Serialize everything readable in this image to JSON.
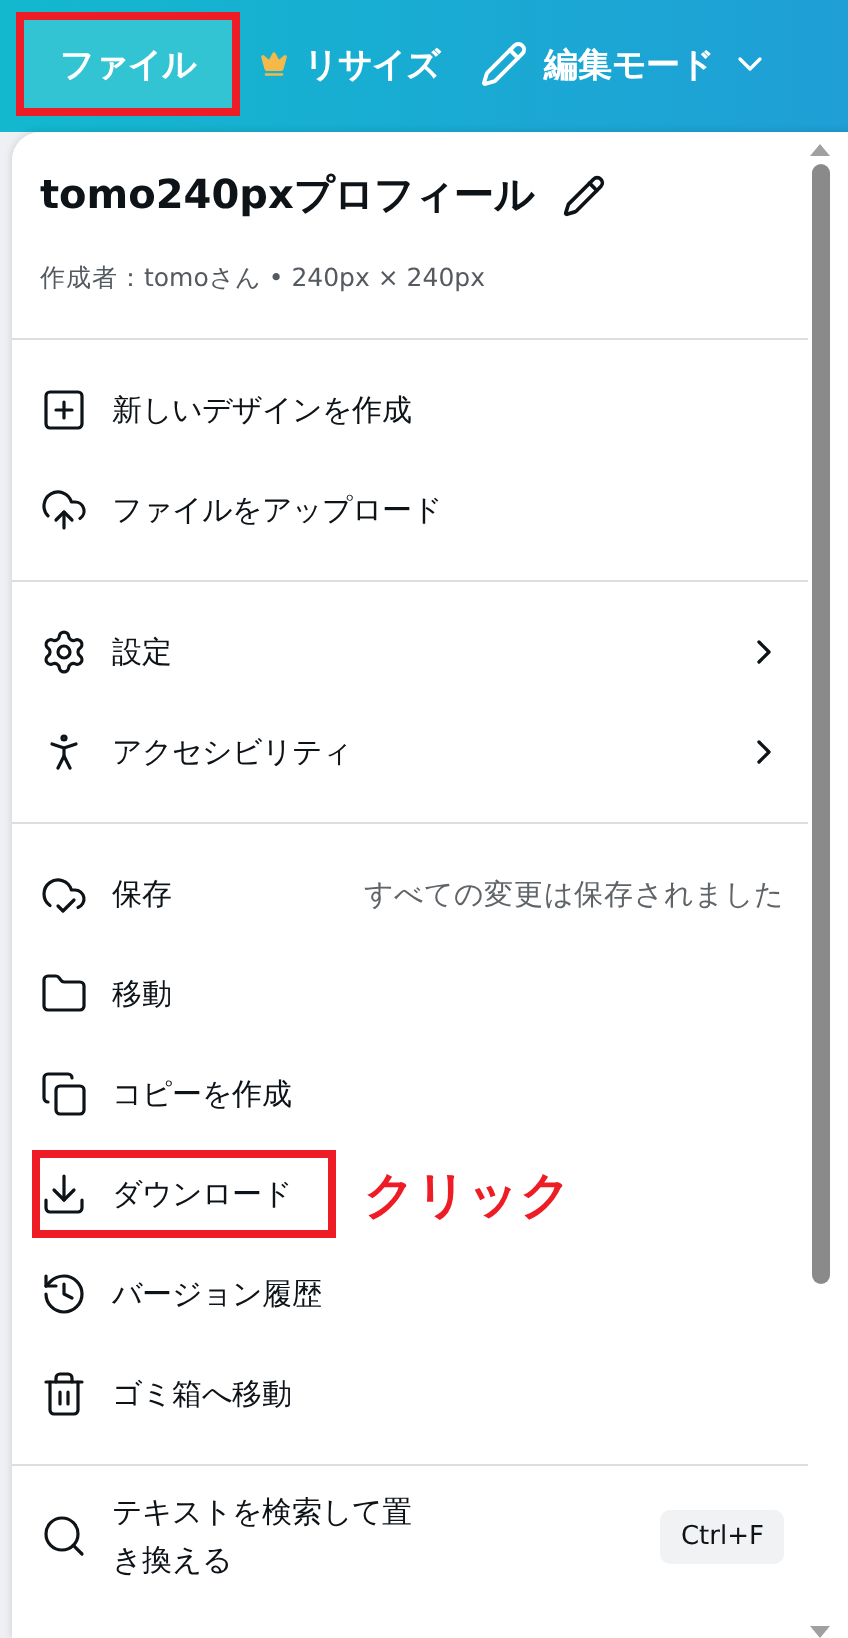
{
  "toolbar": {
    "file_button": {
      "label": "ファイル",
      "highlighted": true
    },
    "resize_button": {
      "label": "リサイズ"
    },
    "mode_button": {
      "label": "編集モード"
    }
  },
  "menu": {
    "title": "tomo240pxプロフィール",
    "subtitle": "作成者：tomoさん • 240px × 240px",
    "sections": [
      {
        "items": [
          {
            "kind": "action",
            "label": "新しいデザインを作成",
            "highlighted": false
          },
          {
            "kind": "action",
            "label": "ファイルをアップロード",
            "highlighted": false
          }
        ]
      },
      {
        "items": [
          {
            "kind": "submenu",
            "label": "設定",
            "highlighted": false
          },
          {
            "kind": "submenu",
            "label": "アクセシビリティ",
            "highlighted": false
          }
        ]
      },
      {
        "items": [
          {
            "kind": "status",
            "label": "保存",
            "status": "すべての変更は保存されました",
            "highlighted": false
          },
          {
            "kind": "action",
            "label": "移動",
            "highlighted": false
          },
          {
            "kind": "action",
            "label": "コピーを作成",
            "highlighted": false
          },
          {
            "kind": "action",
            "label": "ダウンロード",
            "highlighted": true,
            "callout": "クリック"
          },
          {
            "kind": "action",
            "label": "バージョン履歴",
            "highlighted": false
          },
          {
            "kind": "action",
            "label": "ゴミ箱へ移動",
            "highlighted": false
          }
        ]
      },
      {
        "items": [
          {
            "kind": "shortcut",
            "label": "テキストを検索して置き換える",
            "shortcut": "Ctrl+F",
            "highlighted": false
          }
        ]
      }
    ]
  }
}
